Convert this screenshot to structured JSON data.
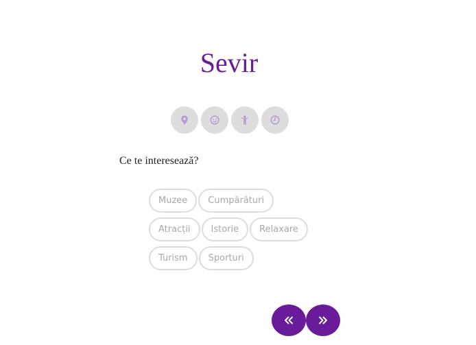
{
  "app": {
    "title": "Sevir"
  },
  "steps": [
    {
      "icon": "map-pin-icon"
    },
    {
      "icon": "smiley-icon"
    },
    {
      "icon": "person-icon"
    },
    {
      "icon": "clock-icon"
    }
  ],
  "question": "Ce te interesează?",
  "interests": {
    "row1": [
      "Muzee",
      "Cumpărături"
    ],
    "row2": [
      "Atracții",
      "Istorie",
      "Relaxare"
    ],
    "row3": [
      "Turism",
      "Sporturi"
    ]
  },
  "nav": {
    "prev_icon": "double-chevron-left-icon",
    "next_icon": "double-chevron-right-icon"
  },
  "colors": {
    "accent": "#6a1b9a",
    "step_icon": "#b69bd0",
    "step_bg": "#dddddd",
    "chip_border": "#dcdcdc",
    "chip_text": "#a8a8a8"
  }
}
